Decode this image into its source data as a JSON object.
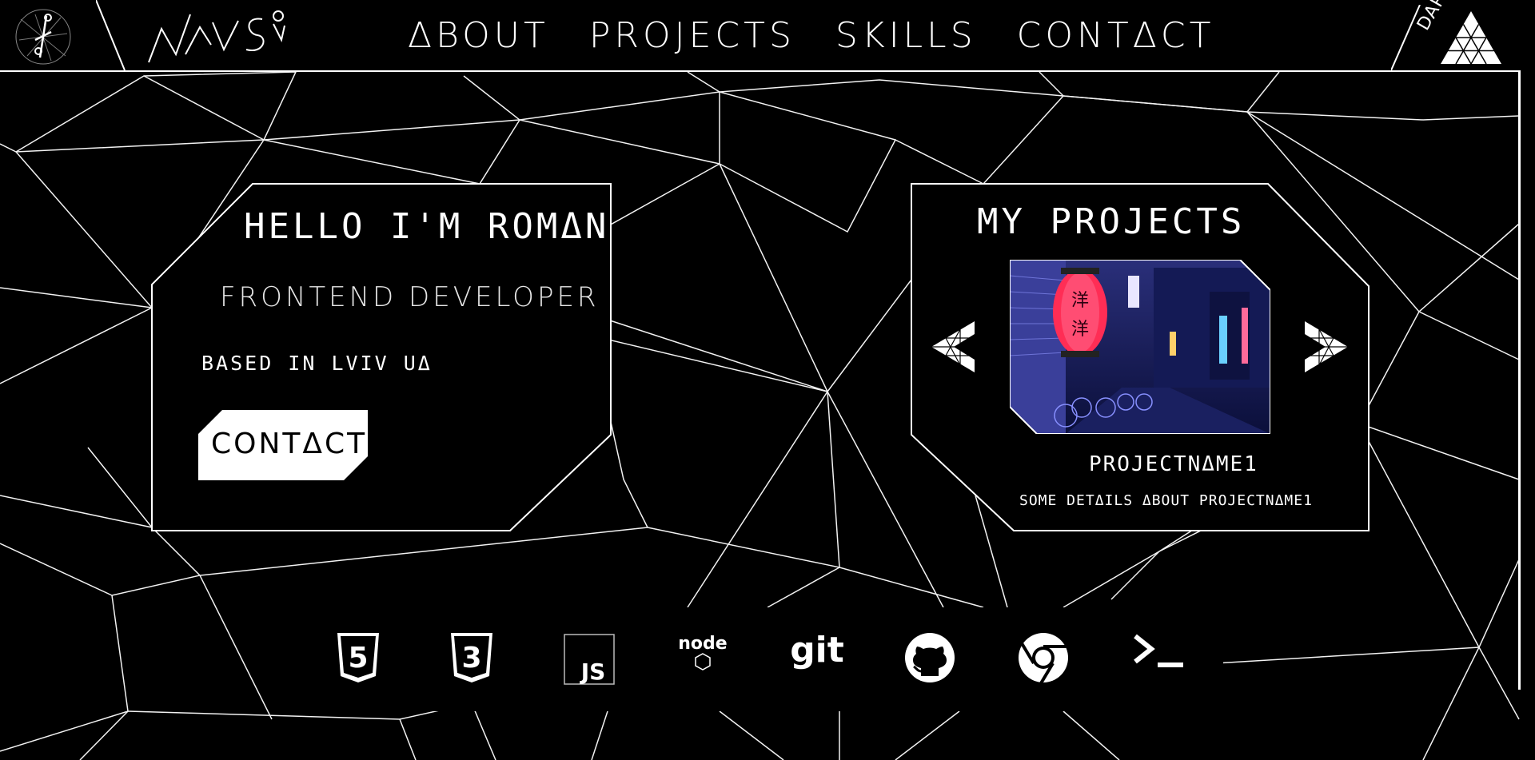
{
  "header": {
    "logo_text": "NAVSI",
    "nav": [
      {
        "label": "ΔBOUT"
      },
      {
        "label": "PROJECTS"
      },
      {
        "label": "SKILLS"
      },
      {
        "label": "CONTΔCT"
      }
    ],
    "theme_toggle_label": "DARK"
  },
  "intro": {
    "greeting": "HELLO I'M ROMΔN",
    "role": "FRONTEND DEVELOPER",
    "location": "BASED IN LVIV UΔ",
    "contact_button": "CONTΔCT"
  },
  "projects": {
    "title": "MY PROJECTS",
    "current": {
      "name": "PROJECTNΔME1",
      "details": "SOME DETΔILS ΔBOUT PROJECTNΔME1",
      "lantern_text": "洋洋"
    }
  },
  "skills": {
    "items": [
      {
        "name": "html5-icon",
        "text": "5"
      },
      {
        "name": "css3-icon",
        "text": "3"
      },
      {
        "name": "javascript-icon",
        "text": "JS"
      },
      {
        "name": "nodejs-icon",
        "text": "node"
      },
      {
        "name": "git-icon",
        "text": "git"
      },
      {
        "name": "github-icon",
        "text": ""
      },
      {
        "name": "chrome-icon",
        "text": ""
      },
      {
        "name": "terminal-icon",
        "text": ""
      }
    ]
  },
  "colors": {
    "background": "#000000",
    "foreground": "#ffffff",
    "lantern": "#ff2d55",
    "photo_bg": "#1a1f5a"
  }
}
